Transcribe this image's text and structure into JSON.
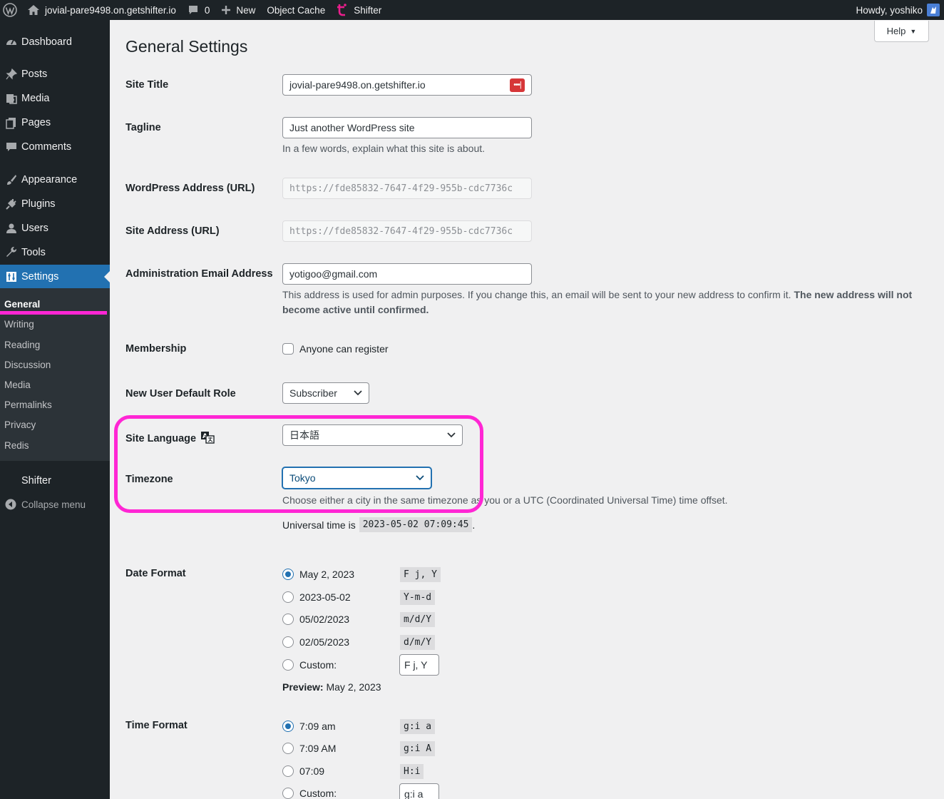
{
  "adminbar": {
    "site_name": "jovial-pare9498.on.getshifter.io",
    "comments_count": "0",
    "new_label": "New",
    "object_cache_label": "Object Cache",
    "shifter_label": "Shifter",
    "howdy": "Howdy, yoshiko"
  },
  "sidebar": {
    "items": [
      {
        "label": "Dashboard"
      },
      {
        "label": "Posts"
      },
      {
        "label": "Media"
      },
      {
        "label": "Pages"
      },
      {
        "label": "Comments"
      },
      {
        "label": "Appearance"
      },
      {
        "label": "Plugins"
      },
      {
        "label": "Users"
      },
      {
        "label": "Tools"
      },
      {
        "label": "Settings"
      },
      {
        "label": "Shifter"
      }
    ],
    "submenu": [
      "General",
      "Writing",
      "Reading",
      "Discussion",
      "Media",
      "Permalinks",
      "Privacy",
      "Redis"
    ],
    "collapse_label": "Collapse menu",
    "current_color": "#2271b1",
    "highlight_color": "#ff26d4"
  },
  "main": {
    "title": "General Settings",
    "help_label": "Help",
    "site_title": {
      "label": "Site Title",
      "value": "jovial-pare9498.on.getshifter.io",
      "password_icon_text": "•••|"
    },
    "tagline": {
      "label": "Tagline",
      "value": "Just another WordPress site",
      "description": "In a few words, explain what this site is about."
    },
    "wp_address": {
      "label": "WordPress Address (URL)",
      "value": "https://fde85832-7647-4f29-955b-cdc7736c"
    },
    "site_address": {
      "label": "Site Address (URL)",
      "value": "https://fde85832-7647-4f29-955b-cdc7736c"
    },
    "admin_email": {
      "label": "Administration Email Address",
      "value": "yotigoo@gmail.com",
      "description": "This address is used for admin purposes. If you change this, an email will be sent to your new address to confirm it.",
      "description_bold": "The new address will not become active until confirmed."
    },
    "membership": {
      "label": "Membership",
      "checkbox_label": "Anyone can register",
      "checked": false
    },
    "default_role": {
      "label": "New User Default Role",
      "value": "Subscriber"
    },
    "site_language": {
      "label": "Site Language",
      "value": "日本語"
    },
    "timezone": {
      "label": "Timezone",
      "value": "Tokyo",
      "description": "Choose either a city in the same timezone as you or a UTC (Coordinated Universal Time) time offset.",
      "universal_prefix": "Universal time is",
      "universal_time": "2023-05-02 07:09:45",
      "universal_suffix": "."
    },
    "date_format": {
      "label": "Date Format",
      "options": [
        {
          "label": "May 2, 2023",
          "code": "F j, Y",
          "checked": true
        },
        {
          "label": "2023-05-02",
          "code": "Y-m-d",
          "checked": false
        },
        {
          "label": "05/02/2023",
          "code": "m/d/Y",
          "checked": false
        },
        {
          "label": "02/05/2023",
          "code": "d/m/Y",
          "checked": false
        }
      ],
      "custom_label": "Custom:",
      "custom_value": "F j, Y",
      "preview_label": "Preview:",
      "preview_value": "May 2, 2023"
    },
    "time_format": {
      "label": "Time Format",
      "options": [
        {
          "label": "7:09 am",
          "code": "g:i a",
          "checked": true
        },
        {
          "label": "7:09 AM",
          "code": "g:i A",
          "checked": false
        },
        {
          "label": "07:09",
          "code": "H:i",
          "checked": false
        }
      ],
      "custom_label": "Custom:",
      "custom_value": "g:i a"
    }
  }
}
